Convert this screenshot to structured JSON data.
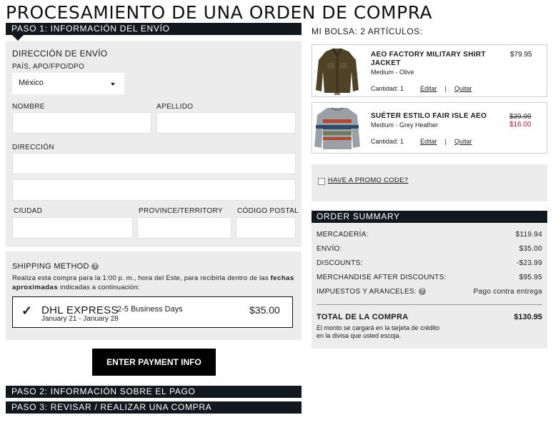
{
  "page_title": "PROCESAMIENTO DE UNA ORDEN DE COMPRA",
  "step1": {
    "label": "PASO 1: INFORMACIÓN DEL ENVÍO",
    "section_title": "DIRECCIÓN DE ENVÍO",
    "country_label": "PAÍS, APO/FPO/DPO",
    "country_value": "México",
    "nombre_label": "NOMBRE",
    "apellido_label": "APELLIDO",
    "direccion_label": "DIRECCIÓN",
    "ciudad_label": "CIUDAD",
    "province_label": "PROVINCE/TERRITORY",
    "codigo_label": "CÓDIGO POSTAL",
    "nombre_value": "",
    "apellido_value": "",
    "direccion1_value": "",
    "direccion2_value": "",
    "ciudad_value": "",
    "province_value": "",
    "codigo_value": ""
  },
  "shipping": {
    "title": "SHIPPING METHOD",
    "help_glyph": "?",
    "desc_part1": "Realiza esta compra para la 1:00 p. m., hora del Este, para recibirla dentro de las",
    "desc_bold": "fechas aproximadas",
    "desc_part2": " indicadas a continuación:",
    "check": "✓",
    "carrier": "DHL EXPRESS",
    "days": "2-5 Business Days",
    "dates": "January 21 - January 28",
    "price": "$35.00"
  },
  "payment_button": "ENTER PAYMENT INFO",
  "step2": {
    "label": "PASO 2: INFORMACIÓN SOBRE EL PAGO"
  },
  "step3": {
    "label": "PASO 3: REVISAR / REALIZAR UNA COMPRA"
  },
  "bag": {
    "title": "MI BOLSA: 2 ARTÍCULOS:",
    "items": [
      {
        "name_line1": "AEO FACTORY MILITARY SHIRT",
        "name_line2": "JACKET",
        "variant": "Medium - Olive",
        "qty": "Cantidad: 1",
        "edit": "Editar",
        "sep": "|",
        "remove": "Quitar",
        "price": "$79.95"
      },
      {
        "name_line1": "SUÉTER ESTILO FAIR ISLE AEO",
        "variant": "Medium - Grey Heather",
        "qty": "Cantidad: 1",
        "edit": "Editar",
        "sep": "|",
        "remove": "Quitar",
        "old_price": "$39.99",
        "sale_price": "$16.00"
      }
    ]
  },
  "promo": {
    "label": "HAVE A PROMO CODE?"
  },
  "summary": {
    "title": "ORDER SUMMARY",
    "rows": [
      {
        "label": "MERCADERÍA:",
        "value": "$119.94"
      },
      {
        "label": "ENVÍO:",
        "value": "$35.00"
      },
      {
        "label": "DISCOUNTS:",
        "value": "-$23.99"
      },
      {
        "label": "MERCHANDISE AFTER DISCOUNTS:",
        "value": "$95.95"
      },
      {
        "label": "IMPUESTOS Y ARANCELES:",
        "value": "Pago contra entrega"
      }
    ],
    "total_label": "TOTAL DE LA COMPRA",
    "total_value": "$130.95",
    "note_line1": "El monto se cargará en la tarjeta de crédito",
    "note_line2": "en la divisa que usted escoja."
  },
  "colors": {
    "dark_bar": "#12181d",
    "panel": "#ececec",
    "sale_red": "#c8102e"
  }
}
